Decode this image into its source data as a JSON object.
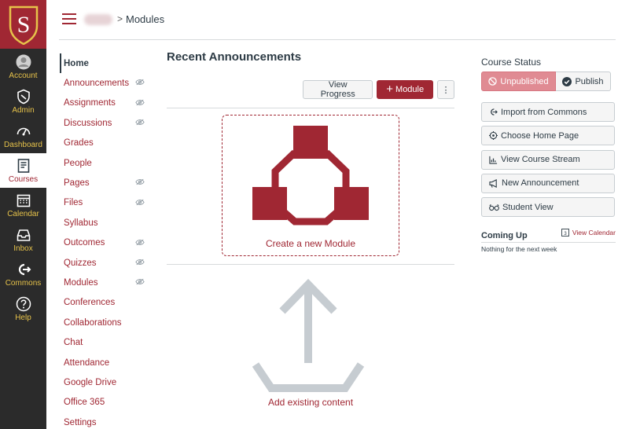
{
  "global_nav": {
    "logo_letter": "S",
    "items": [
      {
        "label": "Account",
        "icon": "account-icon"
      },
      {
        "label": "Admin",
        "icon": "shield-icon"
      },
      {
        "label": "Dashboard",
        "icon": "speedometer-icon"
      },
      {
        "label": "Courses",
        "icon": "book-icon"
      },
      {
        "label": "Calendar",
        "icon": "calendar-icon"
      },
      {
        "label": "Inbox",
        "icon": "inbox-icon"
      },
      {
        "label": "Commons",
        "icon": "commons-icon"
      },
      {
        "label": "Help",
        "icon": "question-icon"
      }
    ],
    "active": "Courses"
  },
  "header": {
    "breadcrumb_sep": ">",
    "breadcrumb_current": "Modules"
  },
  "course_nav": {
    "items": [
      {
        "label": "Home",
        "active": true,
        "hidden": false
      },
      {
        "label": "Announcements",
        "hidden": true
      },
      {
        "label": "Assignments",
        "hidden": true
      },
      {
        "label": "Discussions",
        "hidden": true
      },
      {
        "label": "Grades",
        "hidden": false
      },
      {
        "label": "People",
        "hidden": false
      },
      {
        "label": "Pages",
        "hidden": true
      },
      {
        "label": "Files",
        "hidden": true
      },
      {
        "label": "Syllabus",
        "hidden": false
      },
      {
        "label": "Outcomes",
        "hidden": true
      },
      {
        "label": "Quizzes",
        "hidden": true
      },
      {
        "label": "Modules",
        "hidden": true
      },
      {
        "label": "Conferences",
        "hidden": false
      },
      {
        "label": "Collaborations",
        "hidden": false
      },
      {
        "label": "Chat",
        "hidden": false
      },
      {
        "label": "Attendance",
        "hidden": false
      },
      {
        "label": "Google Drive",
        "hidden": false
      },
      {
        "label": "Office 365",
        "hidden": false
      },
      {
        "label": "Settings",
        "hidden": false
      }
    ]
  },
  "main": {
    "heading": "Recent Announcements",
    "view_progress": "View Progress",
    "add_module": "Module",
    "add_module_plus": "+",
    "kebab": "⋮",
    "create_module": "Create a new Module",
    "add_existing": "Add existing content"
  },
  "sidebar": {
    "status_title": "Course Status",
    "unpublished": "Unpublished",
    "publish": "Publish",
    "buttons": [
      {
        "label": "Import from Commons",
        "icon": "commons-small-icon"
      },
      {
        "label": "Choose Home Page",
        "icon": "target-icon"
      },
      {
        "label": "View Course Stream",
        "icon": "chart-icon"
      },
      {
        "label": "New Announcement",
        "icon": "megaphone-icon"
      },
      {
        "label": "Student View",
        "icon": "glasses-icon"
      }
    ],
    "coming_up": "Coming Up",
    "view_calendar": "View Calendar",
    "calendar_day": "3",
    "nothing": "Nothing for the next week"
  },
  "colors": {
    "brand": "#a02733",
    "nav_bg": "#2b2b2b",
    "nav_text": "#e6c24a"
  }
}
